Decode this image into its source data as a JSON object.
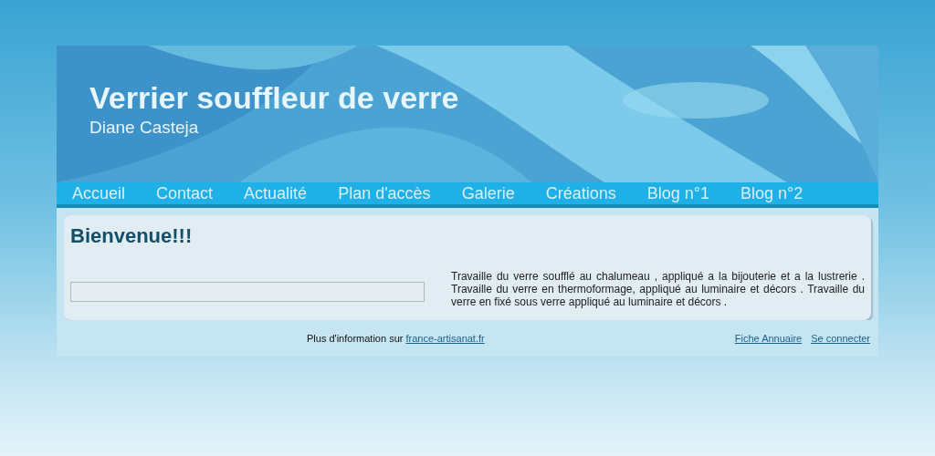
{
  "header": {
    "title": "Verrier souffleur de verre",
    "subtitle": "Diane Casteja"
  },
  "nav": [
    {
      "label": "Accueil"
    },
    {
      "label": "Contact"
    },
    {
      "label": "Actualité"
    },
    {
      "label": "Plan d'accès"
    },
    {
      "label": "Galerie"
    },
    {
      "label": "Créations"
    },
    {
      "label": "Blog n°1"
    },
    {
      "label": "Blog n°2"
    }
  ],
  "content": {
    "heading": "Bienvenue!!!",
    "text": "Travaille du verre soufflé au chalumeau , appliqué a la bijouterie et a la lustrerie . Travaille du verre en thermoformage, appliqué au luminaire et décors . Travaille du verre en fixé sous verre appliqué au luminaire et décors ."
  },
  "footer": {
    "info_text": "Plus d'information sur",
    "info_link": "france-artisanat.fr",
    "links": [
      "Fiche Annuaire",
      "Se connecter"
    ]
  }
}
